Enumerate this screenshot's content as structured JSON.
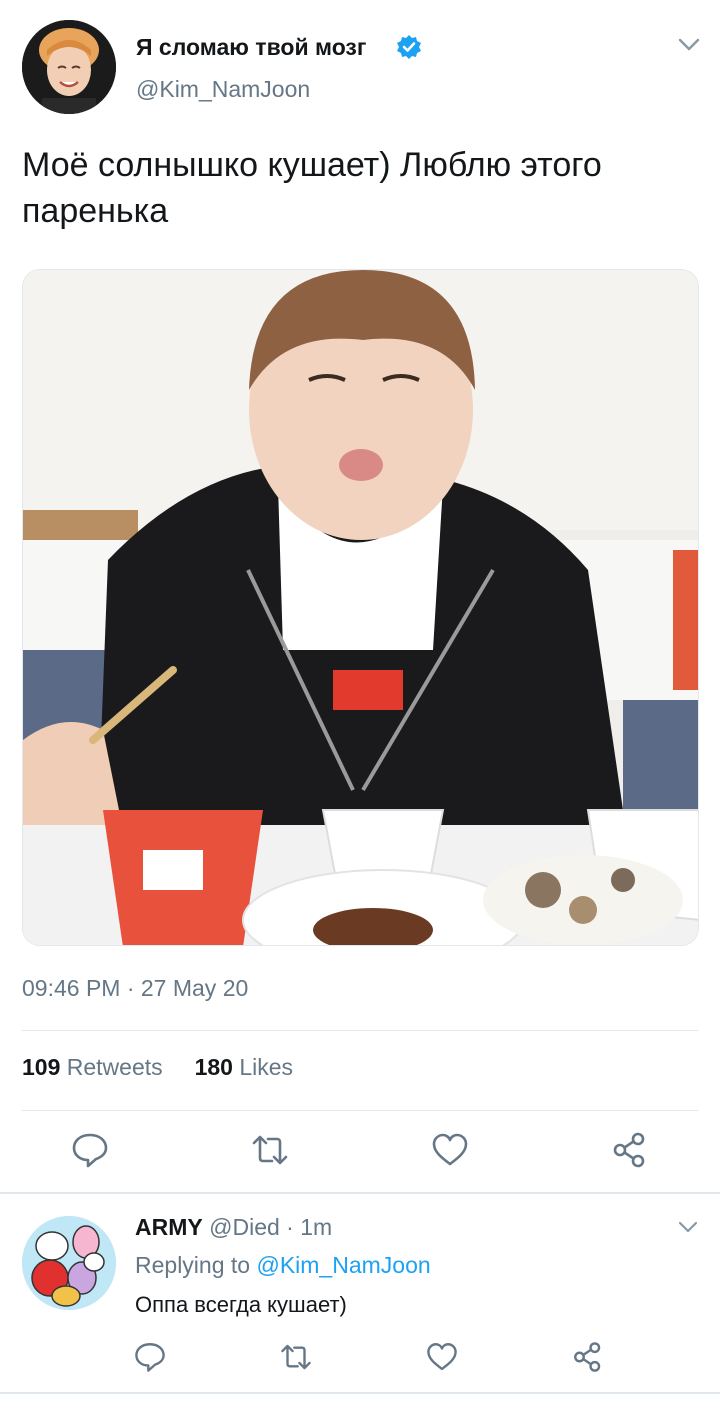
{
  "tweet": {
    "display_name": "Я сломаю твой мозг",
    "handle": "@Kim_NamJoon",
    "text": "Моё солнышко кушает) Люблю этого паренька",
    "timestamp": "09:46 PM · 27 May 20",
    "retweets_count": "109",
    "retweets_label": "Retweets",
    "likes_count": "180",
    "likes_label": "Likes"
  },
  "reply": {
    "name": "ARMY",
    "handle": "@Died",
    "time": "· 1m",
    "replying_prefix": "Replying to ",
    "replying_to": "@Kim_NamJoon",
    "text": "Оппа всегда кушает)"
  },
  "colors": {
    "accent": "#1da1f2",
    "muted": "#657786",
    "text": "#14171a",
    "divider": "#e1e8ed"
  },
  "icons": [
    "verified-badge-icon",
    "chevron-down-icon",
    "reply-icon",
    "retweet-icon",
    "like-icon",
    "share-icon"
  ]
}
